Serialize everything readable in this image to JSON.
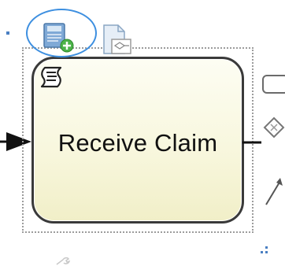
{
  "task": {
    "label": "Receive Claim",
    "type": "script-task",
    "fill_color": "#f8f7de",
    "border_color": "#3a3a3a"
  },
  "context_pad": {
    "highlight_color": "#3d8fe0",
    "items": [
      {
        "icon": "add-task-icon",
        "highlighted": true
      },
      {
        "icon": "document-icon",
        "highlighted": false
      }
    ]
  },
  "palette_right": {
    "items": [
      {
        "icon": "task-shape-icon"
      },
      {
        "icon": "gateway-icon"
      },
      {
        "icon": "connector-icon"
      }
    ]
  }
}
